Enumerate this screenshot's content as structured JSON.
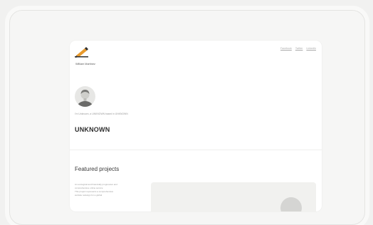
{
  "site": {
    "name": "William Martinez",
    "nav": [
      "Facebook",
      "Twitter",
      "LinkedIn"
    ]
  },
  "intro": {
    "bio": "I'm Unknown, a UNKNOWN based in UNKNOWN",
    "headline": "UNKNOWN"
  },
  "projects": {
    "title": "Featured projects",
    "lines": [
      "An ecological and financially progressive and",
      "comprehensive online service",
      "This project represents a comprehensive",
      "website redesign for a global"
    ]
  },
  "colors": {
    "logo_accent": "#e89a2c",
    "logo_dark": "#2f2f2f"
  }
}
